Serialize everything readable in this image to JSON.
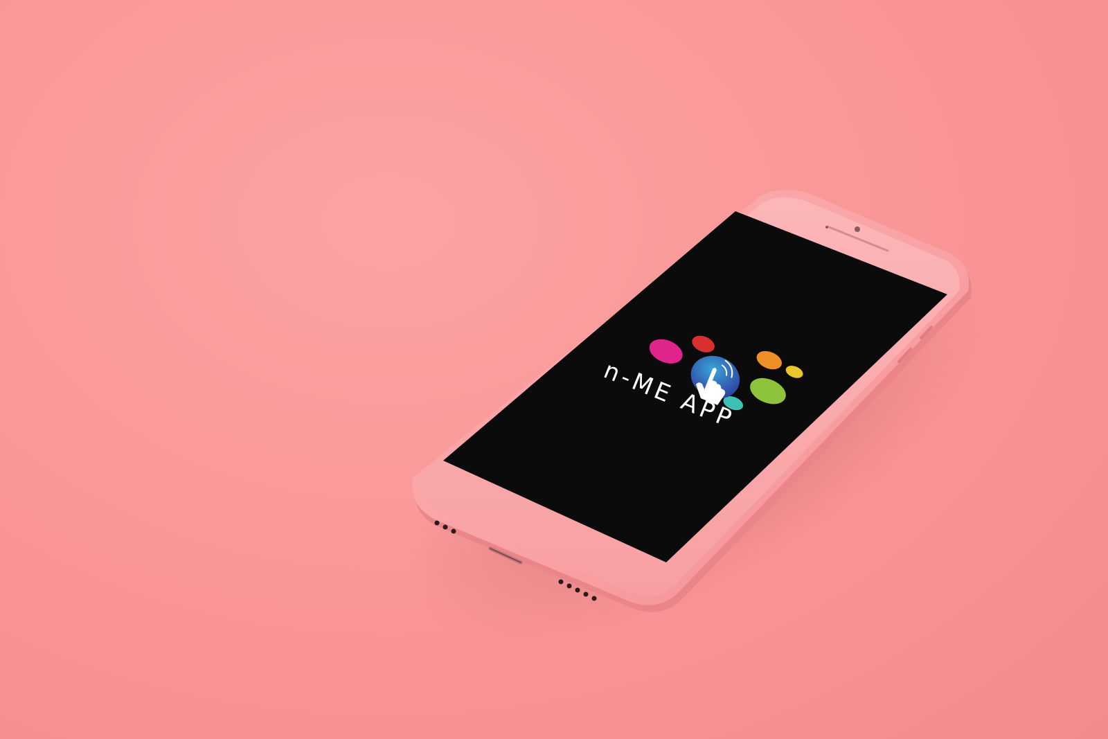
{
  "scene": {
    "background_color": "#f99596",
    "device_body_color": "#f9a0a3",
    "screen_color": "#0b0b0b"
  },
  "app": {
    "name": "n-ME APP",
    "logo": {
      "icon": "tap-hand-icon",
      "bubble_colors": [
        "#e0248c",
        "#d8302e",
        "#ef8f2a",
        "#e9c72c",
        "#8dc43c",
        "#3fc0b4"
      ],
      "center_gradient": [
        "#2e3b9e",
        "#3aa6d8"
      ]
    }
  }
}
